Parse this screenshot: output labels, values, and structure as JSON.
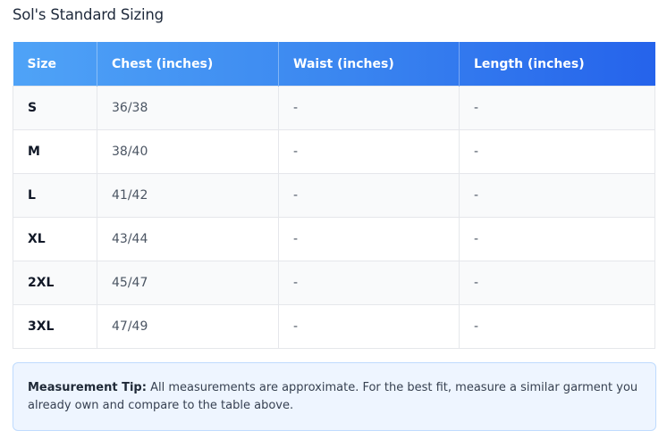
{
  "title": "Sol's Standard Sizing",
  "table": {
    "headers": [
      "Size",
      "Chest (inches)",
      "Waist (inches)",
      "Length (inches)"
    ],
    "rows": [
      {
        "size": "S",
        "chest": "36/38",
        "waist": "-",
        "length": "-"
      },
      {
        "size": "M",
        "chest": "38/40",
        "waist": "-",
        "length": "-"
      },
      {
        "size": "L",
        "chest": "41/42",
        "waist": "-",
        "length": "-"
      },
      {
        "size": "XL",
        "chest": "43/44",
        "waist": "-",
        "length": "-"
      },
      {
        "size": "2XL",
        "chest": "45/47",
        "waist": "-",
        "length": "-"
      },
      {
        "size": "3XL",
        "chest": "47/49",
        "waist": "-",
        "length": "-"
      }
    ]
  },
  "tip": {
    "label": "Measurement Tip:",
    "text": " All measurements are approximate. For the best fit, measure a similar garment you already own and compare to the table above."
  },
  "colors": {
    "header_gradient_start": "#4fa3f7",
    "header_gradient_end": "#2563eb",
    "tip_background": "#eef5ff",
    "tip_border": "#bfdbfe"
  }
}
